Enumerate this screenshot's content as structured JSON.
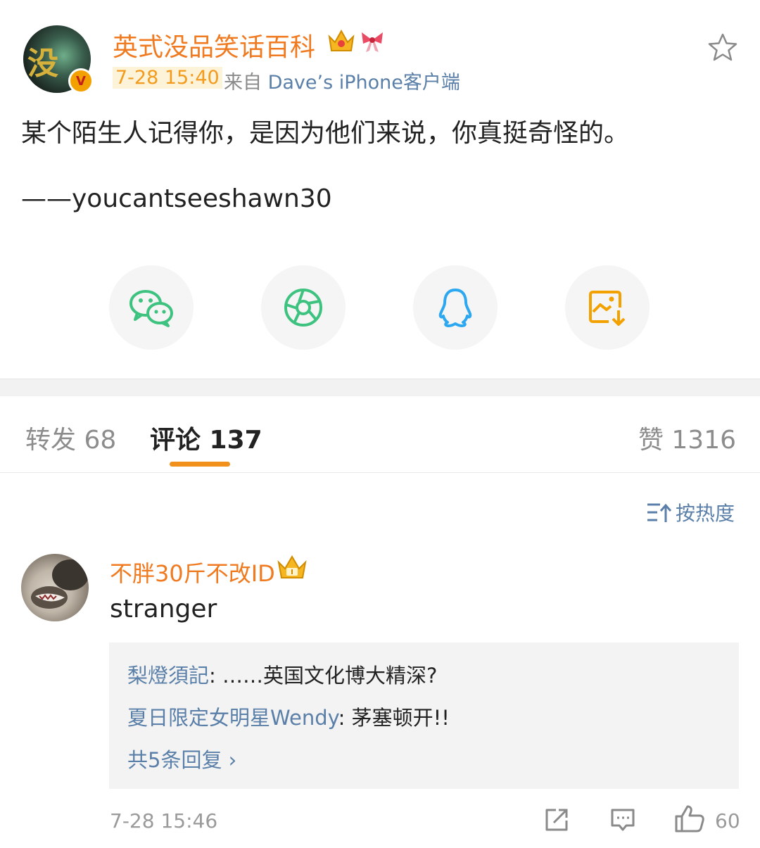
{
  "post": {
    "author": "英式没品笑话百科",
    "avatar_text": "没",
    "verified_mark": "V",
    "time": "7-28 15:40",
    "from_prefix": "来自",
    "device": "Dave’s iPhone客户端",
    "text": "某个陌生人记得你，是因为他们来说，你真挺奇怪的。",
    "signature": "——youcantseeshawn30"
  },
  "share": [
    {
      "name": "wechat",
      "color": "#3ec27f"
    },
    {
      "name": "moments",
      "color": "#3ec27f"
    },
    {
      "name": "qq",
      "color": "#2da8f0"
    },
    {
      "name": "save-image",
      "color": "#f2a100"
    }
  ],
  "tabs": {
    "repost": "转发 68",
    "comments": "评论 137",
    "likes": "赞 1316"
  },
  "sort_label": "按热度",
  "comment": {
    "user": "不胖30斤不改ID",
    "text": "stranger",
    "replies": [
      {
        "user": "梨燈須記",
        "text": ": ……英国文化博大精深?"
      },
      {
        "user": "夏日限定女明星Wendy",
        "text": ": 茅塞顿开!!"
      }
    ],
    "more_replies": "共5条回复 ›",
    "time": "7-28 15:46",
    "like_count": "60"
  },
  "colors": {
    "orange": "#f07a20",
    "link_blue": "#5a7fa8",
    "accent": "#f2901c"
  }
}
